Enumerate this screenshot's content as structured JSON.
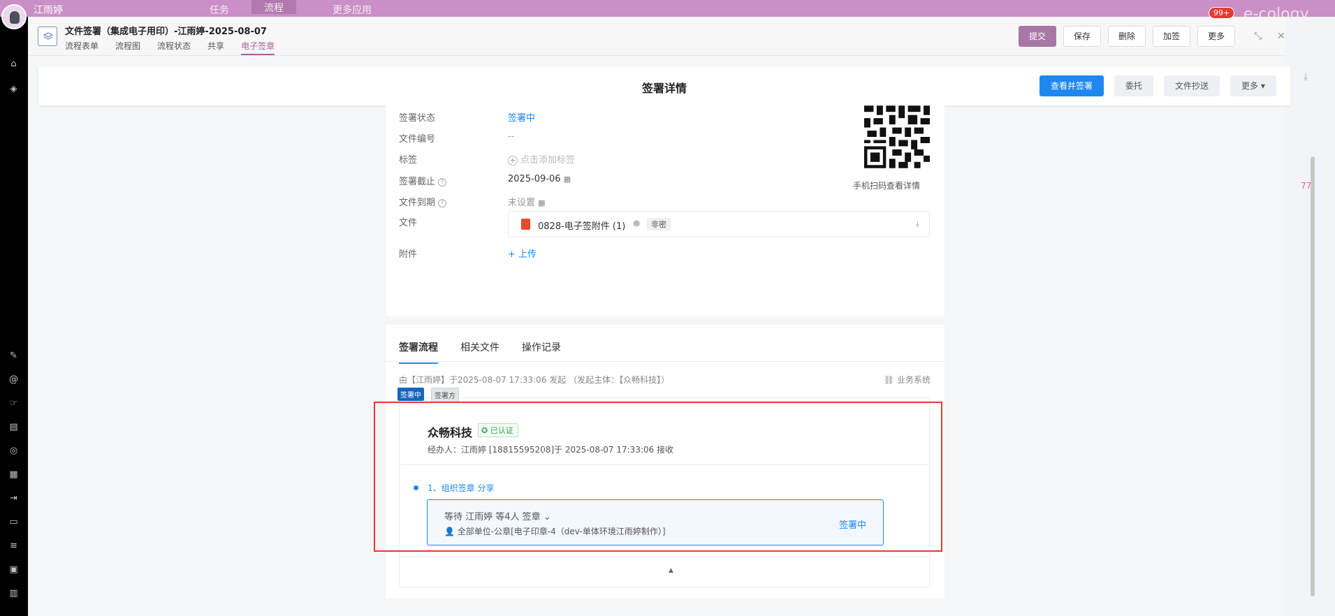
{
  "app": {
    "username": "江雨婷",
    "nav_items": [
      "任务",
      "流程",
      "更多应用"
    ],
    "notification_badge": "99+",
    "brand": "e-cology",
    "right_number": "77"
  },
  "modal": {
    "title": "文件签署（集成电子用印）-江雨婷-2025-08-07",
    "tabs": [
      "流程表单",
      "流程图",
      "流程状态",
      "共享",
      "电子签章"
    ],
    "buttons": {
      "submit": "提交",
      "save": "保存",
      "delete": "删除",
      "countersign": "加签",
      "more": "更多"
    }
  },
  "detail": {
    "title": "签署详情",
    "buttons": {
      "view_sign": "查看并签署",
      "delegate": "委托",
      "copy": "文件抄送",
      "more": "更多"
    }
  },
  "info": {
    "status_label": "签署状态",
    "status_value": "签署中",
    "docno_label": "文件编号",
    "docno_value": "--",
    "tag_label": "标签",
    "tag_placeholder": "点击添加标签",
    "deadline_label": "签署截止",
    "deadline_value": "2025-09-06",
    "expiry_label": "文件到期",
    "expiry_value": "未设置",
    "file_label": "文件",
    "file_name": "0828-电子签附件 (1)",
    "file_secrecy": "非密",
    "attach_label": "附件",
    "upload_label": "上传",
    "qr_caption": "手机扫码查看详情"
  },
  "flow": {
    "tabs": [
      "签署流程",
      "相关文件",
      "操作记录"
    ],
    "initiator_text": "由【江雨婷】于2025-08-07 17:33:06 发起 （发起主体：【众畅科技】）",
    "business_system": "业务系统",
    "tag_signing": "签署中",
    "tag_party": "签署方",
    "company": "众畅科技",
    "verified": "已认证",
    "agent": "经办人：江雨婷 [18815595208]",
    "received": "于 2025-08-07 17:33:06 接收",
    "step_label": "1、组织签章  分享",
    "waiting": "等待 江雨婷 等4人 签章",
    "seal": "全部单位-公章[电子印章-4（dev-单体环境江雨婷制作）]",
    "step_status": "签署中"
  },
  "colors": {
    "accent_purple": "#a877a6",
    "primary_blue": "#1e88f0",
    "highlight_red": "#e53935",
    "verified_green": "#2ea44f"
  }
}
